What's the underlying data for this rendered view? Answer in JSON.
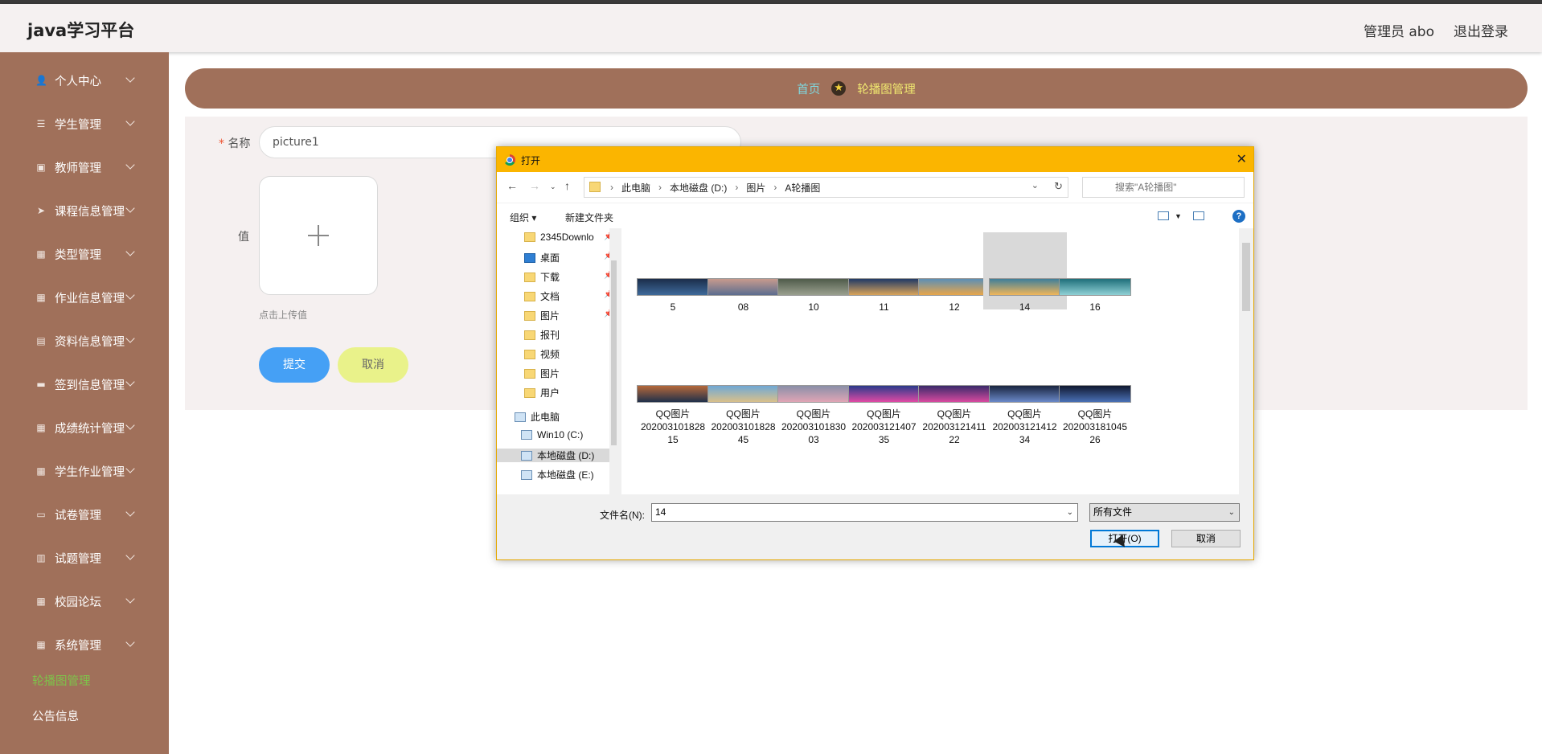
{
  "app": {
    "brand": "java学习平台",
    "user_label": "管理员 abo",
    "logout_label": "退出登录"
  },
  "sidebar": {
    "items": [
      {
        "label": "个人中心",
        "icon": "user-icon"
      },
      {
        "label": "学生管理",
        "icon": "list-icon"
      },
      {
        "label": "教师管理",
        "icon": "image-icon"
      },
      {
        "label": "课程信息管理",
        "icon": "send-icon"
      },
      {
        "label": "类型管理",
        "icon": "grid-icon"
      },
      {
        "label": "作业信息管理",
        "icon": "grid-icon"
      },
      {
        "label": "资料信息管理",
        "icon": "clipboard-icon"
      },
      {
        "label": "签到信息管理",
        "icon": "ticket-icon"
      },
      {
        "label": "成绩统计管理",
        "icon": "grid-icon"
      },
      {
        "label": "学生作业管理",
        "icon": "apps-icon"
      },
      {
        "label": "试卷管理",
        "icon": "monitor-icon"
      },
      {
        "label": "试题管理",
        "icon": "chart-icon"
      },
      {
        "label": "校园论坛",
        "icon": "grid-icon"
      },
      {
        "label": "系统管理",
        "icon": "grid-icon"
      }
    ],
    "active_plain": "轮播图管理",
    "plain": "公告信息",
    "active_color": "#7ec24a"
  },
  "breadcrumb": {
    "home": "首页",
    "current": "轮播图管理"
  },
  "form": {
    "name_label": "名称",
    "name_value": "picture1",
    "value_label": "值",
    "upload_hint": "点击上传值",
    "submit": "提交",
    "cancel": "取消"
  },
  "dialog": {
    "title": "打开",
    "close": "✕",
    "path": [
      "此电脑",
      "本地磁盘 (D:)",
      "图片",
      "A轮播图"
    ],
    "search_placeholder": "搜索\"A轮播图\"",
    "toolbar": {
      "organize": "组织 ▾",
      "new_folder": "新建文件夹",
      "help": "?"
    },
    "tree": [
      {
        "label": "2345Downlo",
        "pinned": true
      },
      {
        "label": "桌面",
        "pinned": true
      },
      {
        "label": "下载",
        "pinned": true
      },
      {
        "label": "文档",
        "pinned": true
      },
      {
        "label": "图片",
        "pinned": true
      },
      {
        "label": "报刊"
      },
      {
        "label": "视频"
      },
      {
        "label": "图片"
      },
      {
        "label": "用户"
      },
      {
        "label": "此电脑"
      },
      {
        "label": "Win10 (C:)"
      },
      {
        "label": "本地磁盘 (D:)",
        "selected": true
      },
      {
        "label": "本地磁盘 (E:)"
      }
    ],
    "files_row1": [
      "5",
      "08",
      "10",
      "11",
      "12",
      "14",
      "16"
    ],
    "files_row2": [
      [
        "QQ图片",
        "20200310182815"
      ],
      [
        "QQ图片",
        "20200310182845"
      ],
      [
        "QQ图片",
        "20200310183003"
      ],
      [
        "QQ图片",
        "20200312140735"
      ],
      [
        "QQ图片",
        "20200312141122"
      ],
      [
        "QQ图片",
        "20200312141234"
      ],
      [
        "QQ图片",
        "20200318104526"
      ]
    ],
    "selected_file": "14",
    "filename_label": "文件名(N):",
    "filename_value": "14",
    "filetype": "所有文件",
    "open_button": "打开(O)",
    "cancel_button": "取消"
  }
}
